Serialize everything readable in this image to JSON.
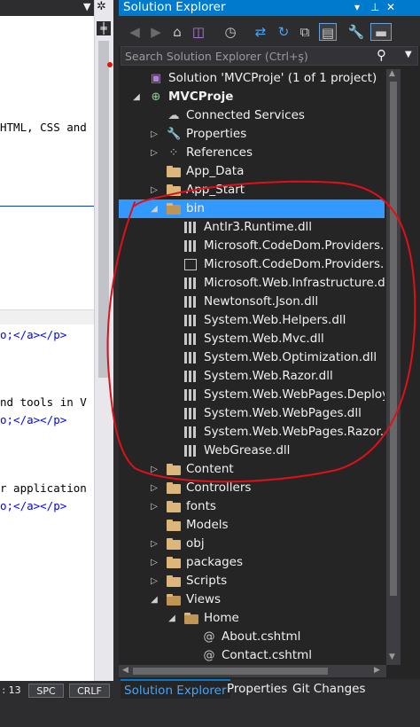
{
  "editor": {
    "lines": [
      {
        "text": "HTML, CSS and",
        "color": "#000000"
      },
      {
        "text": "o;</a></p>",
        "color": "#0000ff"
      },
      {
        "text": "nd tools in V",
        "color": "#000000"
      },
      {
        "text": "o;</a></p>",
        "color": "#0000ff"
      },
      {
        "text": "r application",
        "color": "#000000"
      },
      {
        "text": "o;</a></p>",
        "color": "#0000ff"
      }
    ]
  },
  "statusbar": {
    "col": ": 13",
    "spc": "SPC",
    "crlf": "CRLF"
  },
  "solution_explorer": {
    "title": "Solution Explorer",
    "title_controls": [
      "▾",
      "⊥",
      "✕"
    ],
    "search_placeholder": "Search Solution Explorer (Ctrl+ş)",
    "tree": [
      {
        "label": "Solution 'MVCProje' (1 of 1 project)",
        "depth": 0,
        "expander": "",
        "icon": "solution-icon",
        "bold": false
      },
      {
        "label": "MVCProje",
        "depth": 0,
        "expander": "◢",
        "icon": "web-project-icon",
        "bold": true
      },
      {
        "label": "Connected Services",
        "depth": 1,
        "expander": "",
        "icon": "connected-services-icon"
      },
      {
        "label": "Properties",
        "depth": 1,
        "expander": "▷",
        "icon": "wrench-icon"
      },
      {
        "label": "References",
        "depth": 1,
        "expander": "▷",
        "icon": "references-icon"
      },
      {
        "label": "App_Data",
        "depth": 1,
        "expander": "",
        "icon": "folder-icon"
      },
      {
        "label": "App_Start",
        "depth": 1,
        "expander": "▷",
        "icon": "folder-icon"
      },
      {
        "label": "bin",
        "depth": 1,
        "expander": "◢",
        "icon": "folder-open-icon",
        "selected": true
      },
      {
        "label": "Antlr3.Runtime.dll",
        "depth": 2,
        "expander": "",
        "icon": "dll-icon"
      },
      {
        "label": "Microsoft.CodeDom.Providers.Do",
        "depth": 2,
        "expander": "",
        "icon": "dll-icon"
      },
      {
        "label": "Microsoft.CodeDom.Providers.Do",
        "depth": 2,
        "expander": "",
        "icon": "document-icon"
      },
      {
        "label": "Microsoft.Web.Infrastructure.dll",
        "depth": 2,
        "expander": "",
        "icon": "dll-icon"
      },
      {
        "label": "Newtonsoft.Json.dll",
        "depth": 2,
        "expander": "",
        "icon": "dll-icon"
      },
      {
        "label": "System.Web.Helpers.dll",
        "depth": 2,
        "expander": "",
        "icon": "dll-icon"
      },
      {
        "label": "System.Web.Mvc.dll",
        "depth": 2,
        "expander": "",
        "icon": "dll-icon"
      },
      {
        "label": "System.Web.Optimization.dll",
        "depth": 2,
        "expander": "",
        "icon": "dll-icon"
      },
      {
        "label": "System.Web.Razor.dll",
        "depth": 2,
        "expander": "",
        "icon": "dll-icon"
      },
      {
        "label": "System.Web.WebPages.Deployme",
        "depth": 2,
        "expander": "",
        "icon": "dll-icon"
      },
      {
        "label": "System.Web.WebPages.dll",
        "depth": 2,
        "expander": "",
        "icon": "dll-icon"
      },
      {
        "label": "System.Web.WebPages.Razor.dll",
        "depth": 2,
        "expander": "",
        "icon": "dll-icon"
      },
      {
        "label": "WebGrease.dll",
        "depth": 2,
        "expander": "",
        "icon": "dll-icon"
      },
      {
        "label": "Content",
        "depth": 1,
        "expander": "▷",
        "icon": "folder-icon"
      },
      {
        "label": "Controllers",
        "depth": 1,
        "expander": "▷",
        "icon": "folder-icon"
      },
      {
        "label": "fonts",
        "depth": 1,
        "expander": "▷",
        "icon": "folder-icon"
      },
      {
        "label": "Models",
        "depth": 1,
        "expander": "",
        "icon": "folder-icon"
      },
      {
        "label": "obj",
        "depth": 1,
        "expander": "▷",
        "icon": "folder-icon"
      },
      {
        "label": "packages",
        "depth": 1,
        "expander": "▷",
        "icon": "folder-icon"
      },
      {
        "label": "Scripts",
        "depth": 1,
        "expander": "▷",
        "icon": "folder-icon"
      },
      {
        "label": "Views",
        "depth": 1,
        "expander": "◢",
        "icon": "folder-open-icon"
      },
      {
        "label": "Home",
        "depth": 2,
        "expander": "◢",
        "icon": "folder-open-icon"
      },
      {
        "label": "About.cshtml",
        "depth": 3,
        "expander": "",
        "icon": "cshtml-icon"
      },
      {
        "label": "Contact.cshtml",
        "depth": 3,
        "expander": "",
        "icon": "cshtml-icon"
      }
    ],
    "tabs": [
      "Solution Explorer",
      "Properties",
      "Git Changes"
    ],
    "active_tab": "Solution Explorer"
  },
  "colors": {
    "accent": "#007acc",
    "selection": "#3399ff",
    "annotation": "#e0101a",
    "folder": "#dcb67a"
  }
}
